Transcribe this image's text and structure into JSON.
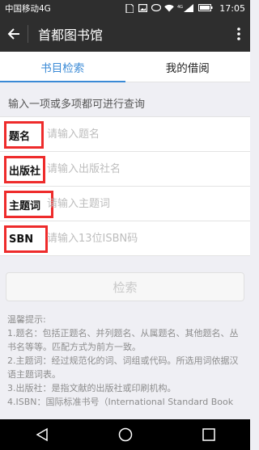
{
  "status_bar": {
    "carrier": "中国移动4G",
    "network_badge": "4G",
    "time": "17:05"
  },
  "app_bar": {
    "title": "首都图书馆"
  },
  "tabs": [
    {
      "label": "书目检索",
      "active": true
    },
    {
      "label": "我的借阅",
      "active": false
    }
  ],
  "hint": "输入一项或多项都可进行查询",
  "fields": [
    {
      "label": "题名",
      "placeholder": "请输入题名",
      "value": ""
    },
    {
      "label": "出版社",
      "placeholder": "请输入出版社名",
      "value": ""
    },
    {
      "label": "主题词",
      "placeholder": "请输入主题词",
      "value": ""
    },
    {
      "label": "SBN",
      "placeholder": "请输入13位ISBN码",
      "value": ""
    }
  ],
  "search_button": "检索",
  "tips": {
    "heading": "温馨提示:",
    "items": [
      "1.题名：包括正题名、并列题名、从属题名、其他题名、丛书名等等。匹配方式为前方一致。",
      "2.主题词：经过规范化的词、词组或代码。所选用词依据汉语主题词表。",
      "3.出版社：是指文献的出版社或印刷机构。",
      "4.ISBN：国际标准书号（International Standard Book"
    ]
  },
  "colors": {
    "accent": "#3a8ad6",
    "highlight_box": "#ee2b2b",
    "appbar": "#2e2e2e"
  }
}
